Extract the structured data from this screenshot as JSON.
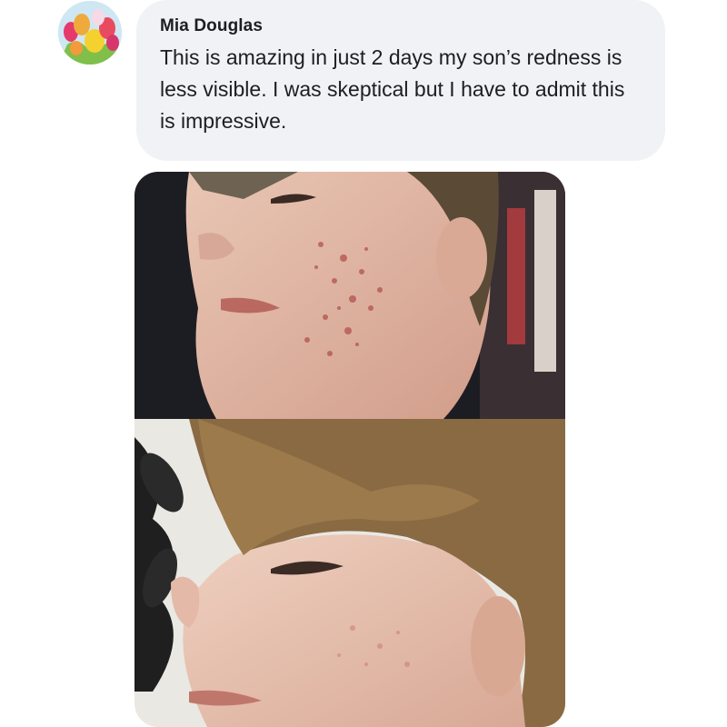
{
  "comment": {
    "author": "Mia Douglas",
    "text": "This is amazing in just 2 days my son’s redness is less visible. I was skeptical but I have to admit this is impressive.",
    "avatar_icon": "tulips-avatar-icon"
  },
  "attachments": {
    "before_photo_icon": "before-photo",
    "after_photo_icon": "after-photo"
  },
  "colors": {
    "bubble": "#f0f2f5",
    "text": "#1c1e21"
  }
}
